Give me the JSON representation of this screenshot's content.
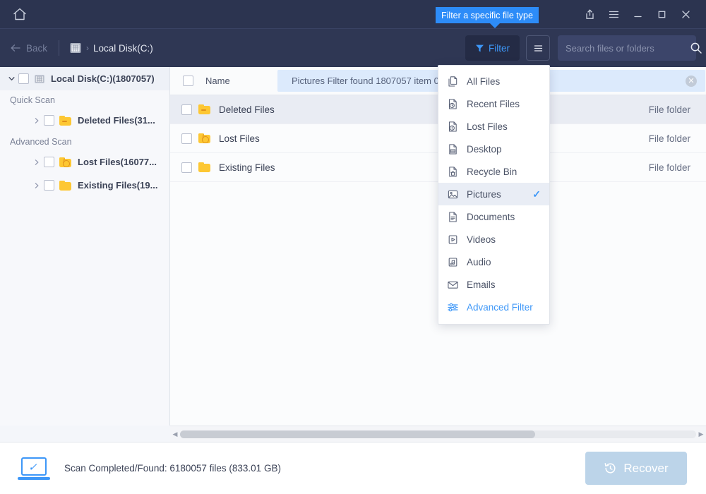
{
  "titlebar": {
    "home_icon": "home-icon",
    "tooltip": "Filter a specific file type",
    "buttons": [
      {
        "name": "share-export-icon",
        "glyph": "⇧"
      },
      {
        "name": "menu-icon",
        "glyph": "☰"
      },
      {
        "name": "minimize-icon",
        "glyph": "—"
      },
      {
        "name": "maximize-icon",
        "glyph": "□"
      },
      {
        "name": "close-icon",
        "glyph": "✕"
      }
    ]
  },
  "navbar": {
    "back_label": "Back",
    "breadcrumb_separator": "›",
    "breadcrumb": "Local Disk(C:)",
    "filter_label": "Filter",
    "search_placeholder": "Search files or folders",
    "search_value": ""
  },
  "sidebar": {
    "root": {
      "label": "Local Disk(C:)(1807057)",
      "expanded": true
    },
    "groups": [
      {
        "header": "Quick Scan",
        "items": [
          {
            "label": "Deleted Files(31...",
            "icon": "folder-deleted-icon"
          }
        ]
      },
      {
        "header": "Advanced Scan",
        "items": [
          {
            "label": "Lost Files(16077...",
            "icon": "folder-lost-icon"
          },
          {
            "label": "Existing Files(19...",
            "icon": "folder-icon"
          }
        ]
      }
    ]
  },
  "list": {
    "column_header_name": "Name",
    "banner": {
      "text": "Pictures Filter found 1807057 item                                                                         00)",
      "close_icon": "close-circle-icon"
    },
    "rows": [
      {
        "name": "Deleted Files",
        "type": "File folder",
        "icon": "folder-deleted-icon",
        "selected": true
      },
      {
        "name": "Lost Files",
        "type": "File folder",
        "icon": "folder-lost-icon",
        "selected": false
      },
      {
        "name": "Existing Files",
        "type": "File folder",
        "icon": "folder-icon",
        "selected": false
      }
    ]
  },
  "dropdown": {
    "items": [
      {
        "label": "All Files",
        "icon": "files-icon",
        "checked": false,
        "accent": false
      },
      {
        "label": "Recent Files",
        "icon": "recent-file-icon",
        "checked": false,
        "accent": false
      },
      {
        "label": "Lost Files",
        "icon": "lost-file-icon",
        "checked": false,
        "accent": false
      },
      {
        "label": "Desktop",
        "icon": "desktop-file-icon",
        "checked": false,
        "accent": false
      },
      {
        "label": "Recycle Bin",
        "icon": "recycle-bin-icon",
        "checked": false,
        "accent": false
      },
      {
        "label": "Pictures",
        "icon": "picture-icon",
        "checked": true,
        "accent": false
      },
      {
        "label": "Documents",
        "icon": "document-icon",
        "checked": false,
        "accent": false
      },
      {
        "label": "Videos",
        "icon": "video-icon",
        "checked": false,
        "accent": false
      },
      {
        "label": "Audio",
        "icon": "audio-icon",
        "checked": false,
        "accent": false
      },
      {
        "label": "Emails",
        "icon": "email-icon",
        "checked": false,
        "accent": false
      },
      {
        "label": "Advanced Filter",
        "icon": "sliders-icon",
        "checked": false,
        "accent": true
      }
    ],
    "checkmark": "✓"
  },
  "statusbar": {
    "scan_text": "Scan Completed/Found: 6180057 files (833.01 GB)",
    "recover_label": "Recover",
    "recover_icon": "restore-clock-icon"
  },
  "colors": {
    "titlebar_bg": "#2c3450",
    "navbar_bg": "#2f3754",
    "accent_blue": "#3d97f8",
    "tooltip_bg": "#2d8cf8",
    "banner_bg": "#dceafc",
    "folder_yellow": "#fdc733",
    "recover_disabled": "#bcd4e9"
  }
}
